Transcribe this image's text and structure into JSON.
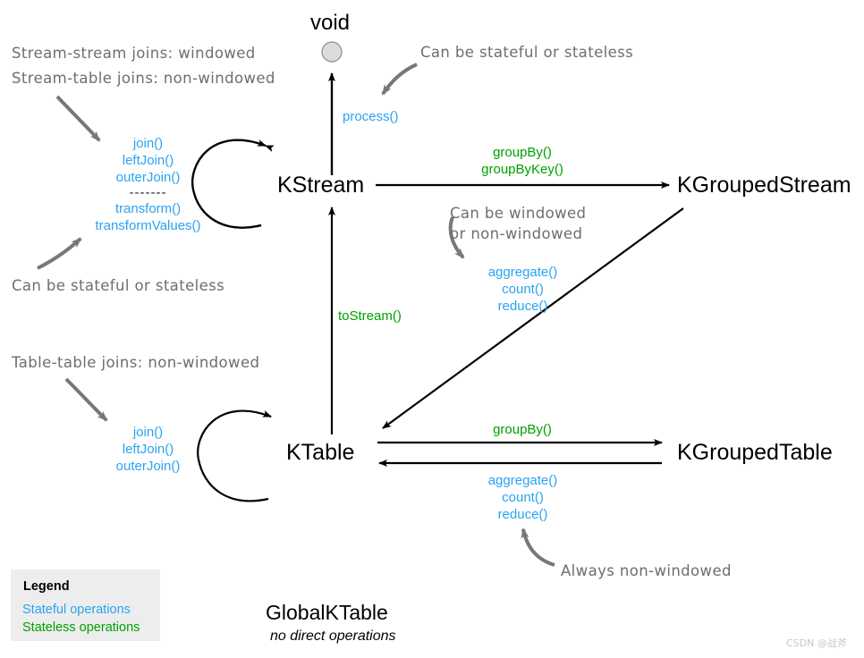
{
  "diagram": {
    "title": "Kafka Streams DSL type transitions",
    "colors": {
      "stateful": "#2aa3f0",
      "stateless": "#00a000",
      "annotation": "#6e6e6e",
      "node": "#000000",
      "legend_bg": "#ededed",
      "void_circle": "#dcdcdc"
    }
  },
  "nodes": {
    "void": "void",
    "kstream": "KStream",
    "ktable": "KTable",
    "kgrouped_stream": "KGroupedStream",
    "kgrouped_table": "KGroupedTable",
    "global_ktable": "GlobalKTable",
    "global_ktable_note": "no direct operations"
  },
  "operations": {
    "kstream_self": {
      "stateful_top": [
        "join()",
        "leftJoin()",
        "outerJoin()"
      ],
      "separator": "-------",
      "stateful_bottom": [
        "transform()",
        "transformValues()"
      ]
    },
    "kstream_to_void": [
      "process()"
    ],
    "kstream_to_kgroupedstream": [
      "groupBy()",
      "groupByKey()"
    ],
    "kgroupedstream_to_ktable": [
      "aggregate()",
      "count()",
      "reduce()"
    ],
    "ktable_to_kstream": [
      "toStream()"
    ],
    "ktable_self": [
      "join()",
      "leftJoin()",
      "outerJoin()"
    ],
    "ktable_to_kgroupedtable": [
      "groupBy()"
    ],
    "kgroupedtable_to_ktable": [
      "aggregate()",
      "count()",
      "reduce()"
    ]
  },
  "annotations": {
    "stream_joins_line1": "Stream-stream joins: windowed",
    "stream_joins_line2": "Stream-table joins: non-windowed",
    "stateful_or_stateless_left": "Can be stateful or stateless",
    "stateful_or_stateless_top": "Can be stateful or stateless",
    "table_joins": "Table-table joins: non-windowed",
    "windowed_line1": "Can be windowed",
    "windowed_line2": "or non-windowed",
    "always_non_windowed": "Always non-windowed"
  },
  "legend": {
    "title": "Legend",
    "stateful": "Stateful operations",
    "stateless": "Stateless operations"
  },
  "watermark": "CSDN @战斧"
}
